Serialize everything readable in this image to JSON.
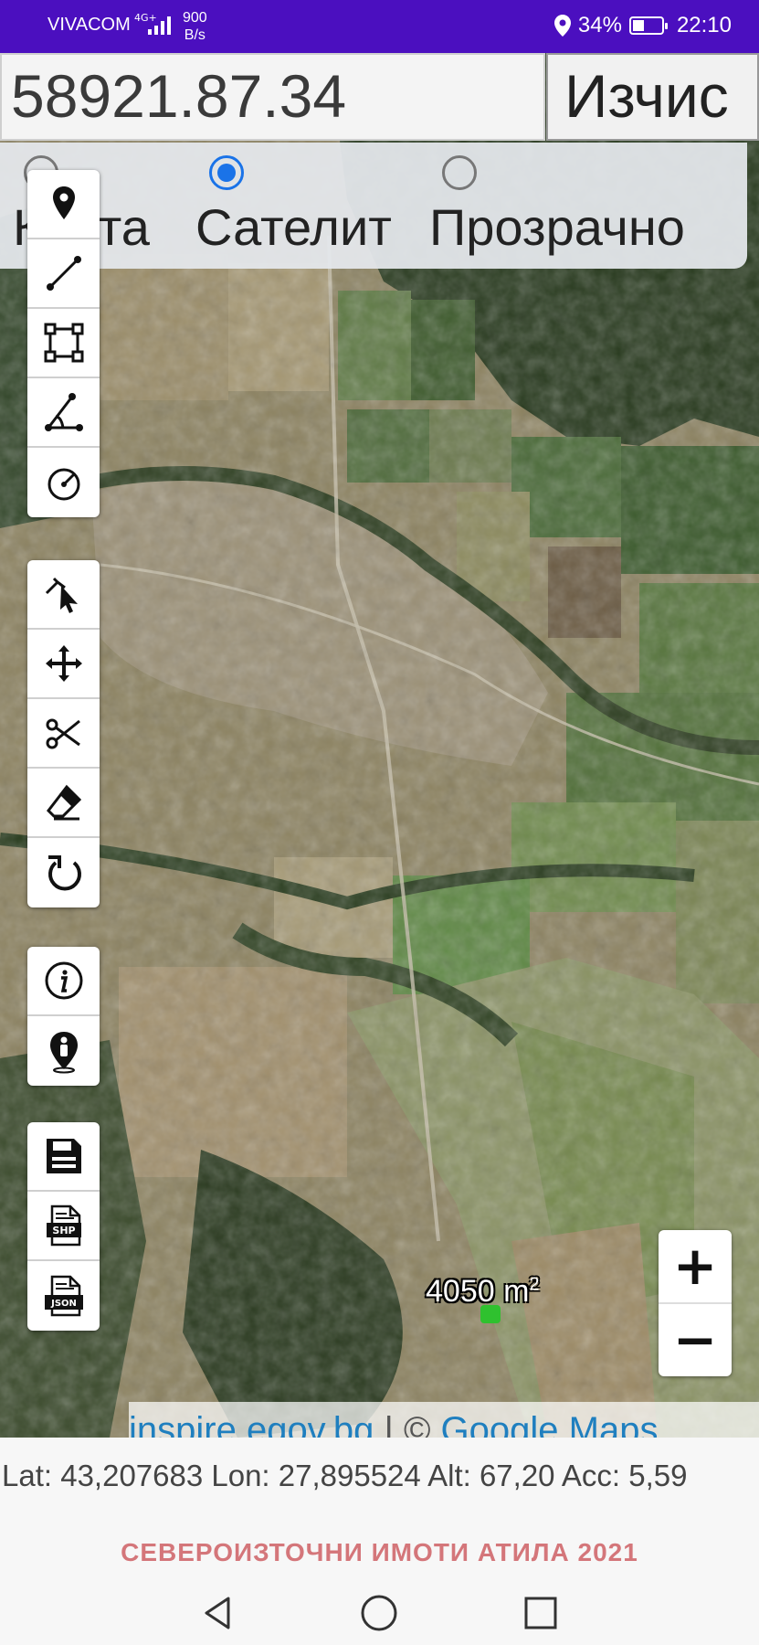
{
  "status_bar": {
    "carrier": "VIVACOM",
    "network": "4G+",
    "speed_value": "900",
    "speed_unit": "B/s",
    "battery": "34%",
    "time": "22:10"
  },
  "top": {
    "coordinate_value": "58921.87.34",
    "calculate_label": "Изчис"
  },
  "layer_options": {
    "map_label": "Карта",
    "satellite_label": "Сателит",
    "transparent_label": "Прозрачно",
    "selected": "Сателит"
  },
  "tools": {
    "group1": [
      "marker-icon",
      "line-icon",
      "polygon-icon",
      "angle-icon",
      "circle-icon"
    ],
    "group2": [
      "select-pointer-icon",
      "move-icon",
      "scissors-icon",
      "eraser-icon",
      "undo-icon"
    ],
    "group3": [
      "info-icon",
      "person-location-icon"
    ],
    "group4": [
      "save-icon",
      "shp-file-icon",
      "json-file-icon"
    ]
  },
  "file_tags": {
    "shp": "SHP",
    "json": "JSON"
  },
  "zoom": {
    "in": "+",
    "out": "−"
  },
  "map_area": {
    "value": "4050 m",
    "sup": "2"
  },
  "attribution": {
    "link1": "inspire.egov.bg",
    "separator": " | © ",
    "link2": "Google Maps"
  },
  "gps": {
    "text": "Lat: 43,207683 Lon: 27,895524 Alt: 67,20 Acc: 5,59"
  },
  "footer": {
    "title": "СЕВЕРОИЗТОЧНИ ИМОТИ АТИЛА 2021"
  },
  "colors": {
    "status_bar": "#4b0fbf",
    "radio_selected": "#1a73e8",
    "footer_text": "#d4767a",
    "link": "#1f7fbf"
  }
}
